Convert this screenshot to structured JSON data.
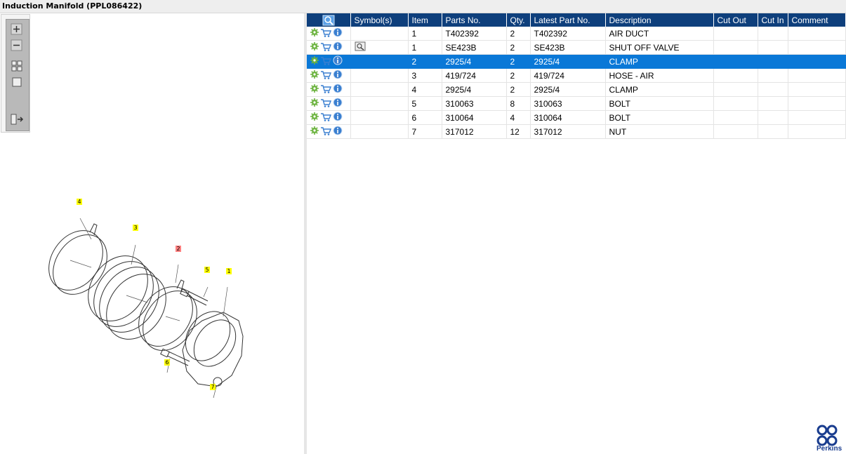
{
  "window": {
    "title": "Induction Manifold (PPL086422)"
  },
  "colors": {
    "header_bg": "#0e3f7c",
    "selected_row": "#0a78d7",
    "callout": "#ffff00",
    "callout_selected": "#ff8080"
  },
  "toolbar": {
    "items": [
      {
        "name": "zoom-in-icon"
      },
      {
        "name": "zoom-out-icon"
      },
      {
        "name": "fit-all-icon"
      },
      {
        "name": "fit-window-icon"
      },
      {
        "name": "expand-panel-icon"
      }
    ]
  },
  "diagram": {
    "callouts": [
      {
        "label": "4"
      },
      {
        "label": "3"
      },
      {
        "label": "2"
      },
      {
        "label": "5"
      },
      {
        "label": "1"
      },
      {
        "label": "6"
      },
      {
        "label": "7"
      }
    ]
  },
  "table": {
    "columns": [
      "",
      "Symbol(s)",
      "Item",
      "Parts No.",
      "Qty.",
      "Latest Part No.",
      "Description",
      "Cut Out",
      "Cut In",
      "Comment"
    ],
    "rows": [
      {
        "item": "1",
        "part": "T402392",
        "qty": "2",
        "latest": "T402392",
        "desc": "AIR DUCT",
        "symbol": false
      },
      {
        "item": "1",
        "part": "SE423B",
        "qty": "2",
        "latest": "SE423B",
        "desc": "SHUT OFF VALVE",
        "symbol": true
      },
      {
        "item": "2",
        "part": "2925/4",
        "qty": "2",
        "latest": "2925/4",
        "desc": "CLAMP",
        "symbol": false,
        "selected": true
      },
      {
        "item": "3",
        "part": "419/724",
        "qty": "2",
        "latest": "419/724",
        "desc": "HOSE - AIR",
        "symbol": false
      },
      {
        "item": "4",
        "part": "2925/4",
        "qty": "2",
        "latest": "2925/4",
        "desc": "CLAMP",
        "symbol": false
      },
      {
        "item": "5",
        "part": "310063",
        "qty": "8",
        "latest": "310063",
        "desc": "BOLT",
        "symbol": false
      },
      {
        "item": "6",
        "part": "310064",
        "qty": "4",
        "latest": "310064",
        "desc": "BOLT",
        "symbol": false
      },
      {
        "item": "7",
        "part": "317012",
        "qty": "12",
        "latest": "317012",
        "desc": "NUT",
        "symbol": false
      }
    ]
  },
  "brand": {
    "name": "Perkins"
  }
}
